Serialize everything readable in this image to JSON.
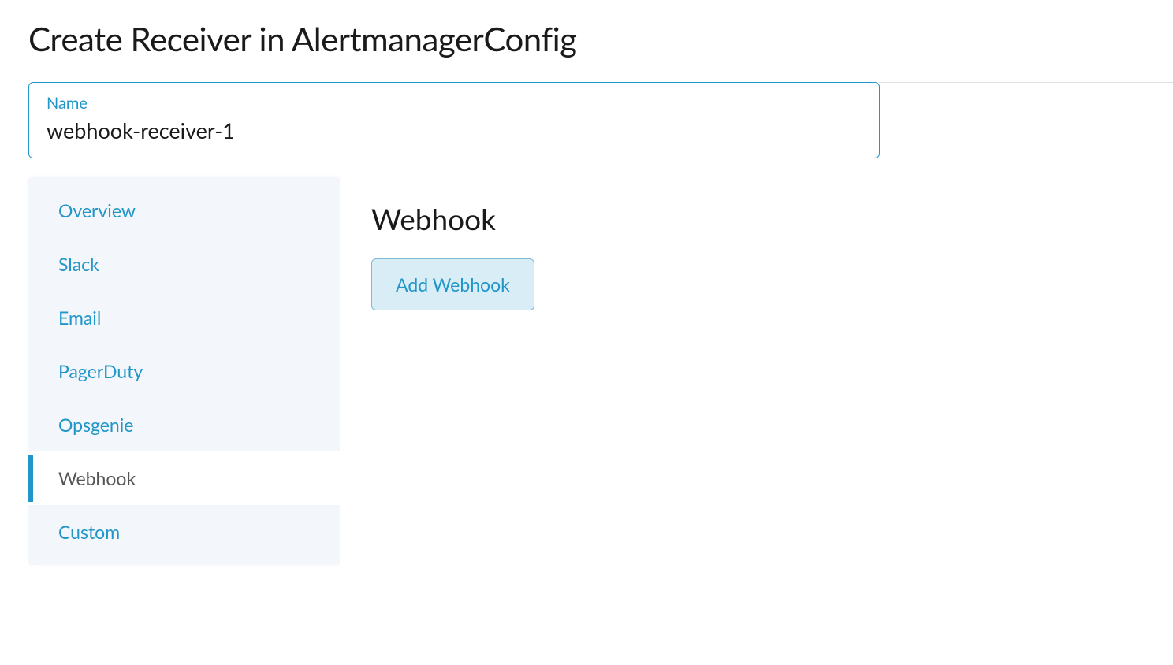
{
  "page": {
    "title": "Create Receiver in AlertmanagerConfig"
  },
  "nameField": {
    "label": "Name",
    "value": "webhook-receiver-1"
  },
  "sidebar": {
    "items": [
      {
        "label": "Overview",
        "active": false
      },
      {
        "label": "Slack",
        "active": false
      },
      {
        "label": "Email",
        "active": false
      },
      {
        "label": "PagerDuty",
        "active": false
      },
      {
        "label": "Opsgenie",
        "active": false
      },
      {
        "label": "Webhook",
        "active": true
      },
      {
        "label": "Custom",
        "active": false
      }
    ]
  },
  "main": {
    "sectionTitle": "Webhook",
    "addButtonLabel": "Add Webhook"
  }
}
